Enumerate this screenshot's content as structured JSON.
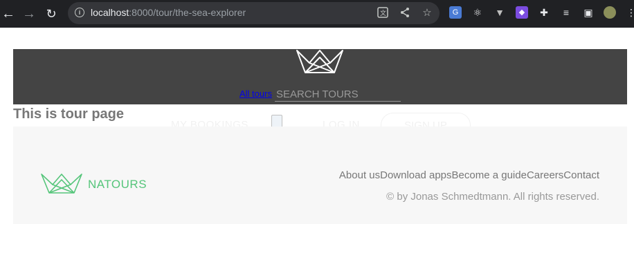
{
  "browser": {
    "url_host": "localhost",
    "url_path": ":8000/tour/the-sea-explorer",
    "icons": [
      "back-icon",
      "forward-icon",
      "reload-icon",
      "info-icon",
      "translate-icon",
      "share-icon",
      "star-icon",
      "google-translate-icon",
      "react-devtools-icon",
      "vue-devtools-icon",
      "extension-icon",
      "puzzle-icon",
      "media-icon",
      "sidebar-icon",
      "profile-avatar-icon",
      "menu-icon"
    ]
  },
  "header": {
    "all_tours_label": "All tours",
    "search_placeholder": "SEARCH TOURS"
  },
  "main": {
    "title": "This is tour page"
  },
  "hidden_nav": {
    "my_bookings": "MY BOOKINGS",
    "login": "LOG IN",
    "signup": "SIGN UP"
  },
  "footer": {
    "brand": "NATOURS",
    "links": [
      "About us",
      "Download apps",
      "Become a guide",
      "Careers",
      "Contact"
    ],
    "copyright": "© by Jonas Schmedtmann. All rights reserved."
  },
  "colors": {
    "header_bg": "#444444",
    "brand_green": "#55c57a",
    "footer_bg": "#f7f7f7"
  }
}
